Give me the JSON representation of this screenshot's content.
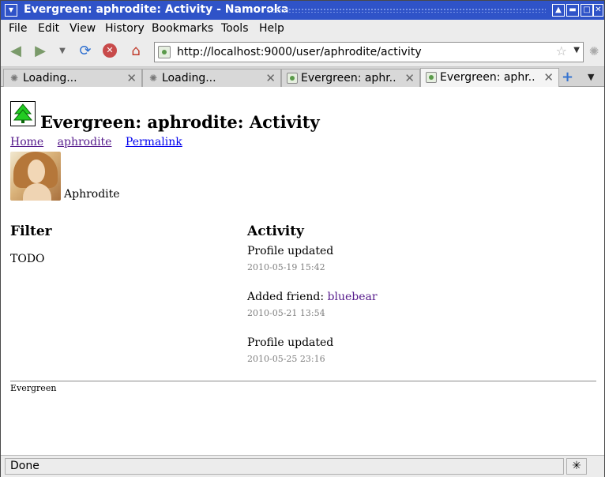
{
  "window": {
    "title": "Evergreen: aphrodite: Activity - Namoroka"
  },
  "menu": {
    "items": [
      "File",
      "Edit",
      "View",
      "History",
      "Bookmarks",
      "Tools",
      "Help"
    ]
  },
  "toolbar": {
    "url": "http://localhost:9000/user/aphrodite/activity"
  },
  "tabs": [
    {
      "label": "Loading...",
      "icon": "spinner-icon"
    },
    {
      "label": "Loading...",
      "icon": "spinner-icon"
    },
    {
      "label": "Evergreen: aphr...",
      "icon": "page-icon"
    },
    {
      "label": "Evergreen: aphr...",
      "icon": "page-icon",
      "active": true
    }
  ],
  "page": {
    "title": "Evergreen: aphrodite: Activity",
    "breadcrumbs": [
      "Home",
      "aphrodite",
      "Permalink"
    ],
    "user_display_name": "Aphrodite",
    "filter_heading": "Filter",
    "filter_text": "TODO",
    "activity_heading": "Activity",
    "activity": [
      {
        "text": "Profile updated",
        "link": "",
        "time": "2010-05-19 15:42"
      },
      {
        "text": "Added friend: ",
        "link": "bluebear",
        "time": "2010-05-21 13:54"
      },
      {
        "text": "Profile updated",
        "link": "",
        "time": "2010-05-25 23:16"
      }
    ],
    "footer": "Evergreen"
  },
  "status": {
    "text": "Done"
  }
}
